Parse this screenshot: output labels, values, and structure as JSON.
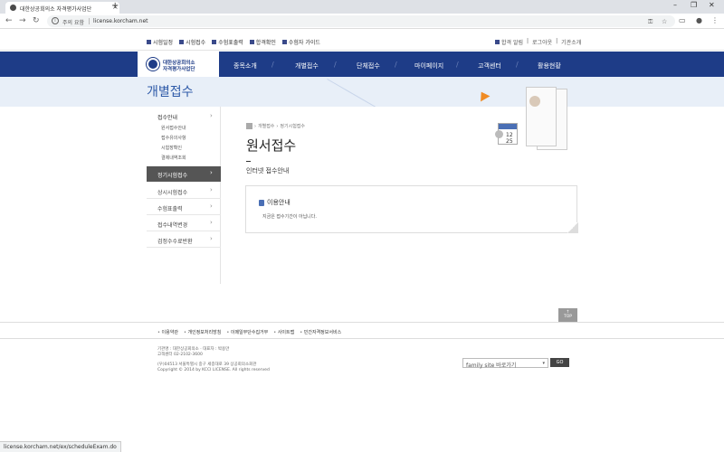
{
  "browser": {
    "tab_title": "대한상공회의소 자격평가사업단",
    "security_label": "주의 요함",
    "url": "license.korcham.net",
    "status_url": "license.korcham.net/ex/scheduleExam.do",
    "new_tab": "+",
    "tab_close": "×"
  },
  "util_nav": {
    "left": [
      "시험일정",
      "시험접수",
      "수험표출력",
      "합격확인",
      "수험자 가이드"
    ],
    "right": [
      "합격 알림",
      "로그아웃",
      "기관소개"
    ]
  },
  "logo": {
    "line1": "대한상공회의소",
    "line2": "자격평가사업단"
  },
  "gnb": [
    "종목소개",
    "개별접수",
    "단체접수",
    "마이페이지",
    "고객센터",
    "활용현황"
  ],
  "sub_visual_title": "개별접수",
  "lnb": {
    "head": "접수안내",
    "subs": [
      "원서접수안내",
      "접수유의사항",
      "시험장확인",
      "결제내역조회"
    ],
    "active": "정기시험접수",
    "items": [
      "상시시험접수",
      "수험표출력",
      "접수내역변경",
      "검정수수료반환"
    ]
  },
  "breadcrumb": [
    "개별접수",
    "정기시험접수"
  ],
  "page_title": "원서접수",
  "subtitle": "인터넷 접수안내",
  "info_box": {
    "heading": "이용안내",
    "text": "지금은 접수기간이 아닙니다."
  },
  "illustration": {
    "cal_day1": "12",
    "cal_day2": "25"
  },
  "top_button": {
    "arrow": "↑",
    "label": "TOP"
  },
  "footer_nav": [
    "이용약관",
    "개인정보처리방침",
    "이메일무단수집거부",
    "사이트맵",
    "민간자격정보서비스"
  ],
  "footer_info": {
    "line1": "기관명 : 대한상공회의소 · 대표자 : 박용만",
    "line2": "고객센터 02-2102-3600",
    "line3": "(우)04513 서울특별시 중구 세종대로 39 상공회의소회관",
    "line4": "Copyright © 2014 by KCCI LICENSE. All rights reserved"
  },
  "family_site": {
    "label": "family site 바로가기",
    "go": "GO"
  },
  "colors": {
    "nav_bg": "#1e3c87",
    "accent": "#2e5aa8",
    "active_menu": "#555555"
  }
}
